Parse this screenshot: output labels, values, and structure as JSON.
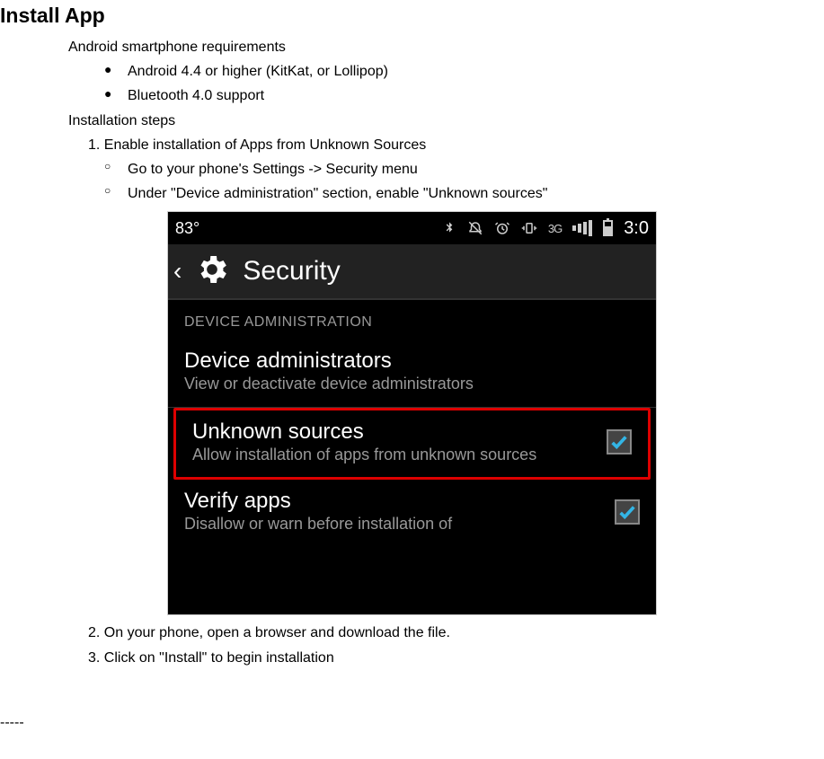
{
  "heading": "Install App",
  "requirements_label": "Android smartphone requirements",
  "requirements": [
    "Android 4.4 or higher (KitKat, or Lollipop)",
    "Bluetooth 4.0 support"
  ],
  "install_steps_label": "Installation steps",
  "step1": "1. Enable installation of Apps from Unknown Sources",
  "step1_subs": [
    "Go to your phone's Settings -> Security menu",
    "Under \"Device administration\" section, enable \"Unknown sources\""
  ],
  "step2": "2. On your phone, open a browser and download the file.",
  "step3": "3. Click on \"Install\" to begin installation",
  "dashes": "-----",
  "screenshot": {
    "status": {
      "temp": "83°",
      "net_label": "3G",
      "clock": "3:0"
    },
    "appbar_title": "Security",
    "section_title": "DEVICE ADMINISTRATION",
    "items": [
      {
        "title": "Device administrators",
        "sub": "View or deactivate device administrators"
      },
      {
        "title": "Unknown sources",
        "sub": "Allow installation of apps from unknown sources",
        "checked": true
      },
      {
        "title": "Verify apps",
        "sub": "Disallow or warn before installation of"
      }
    ]
  }
}
